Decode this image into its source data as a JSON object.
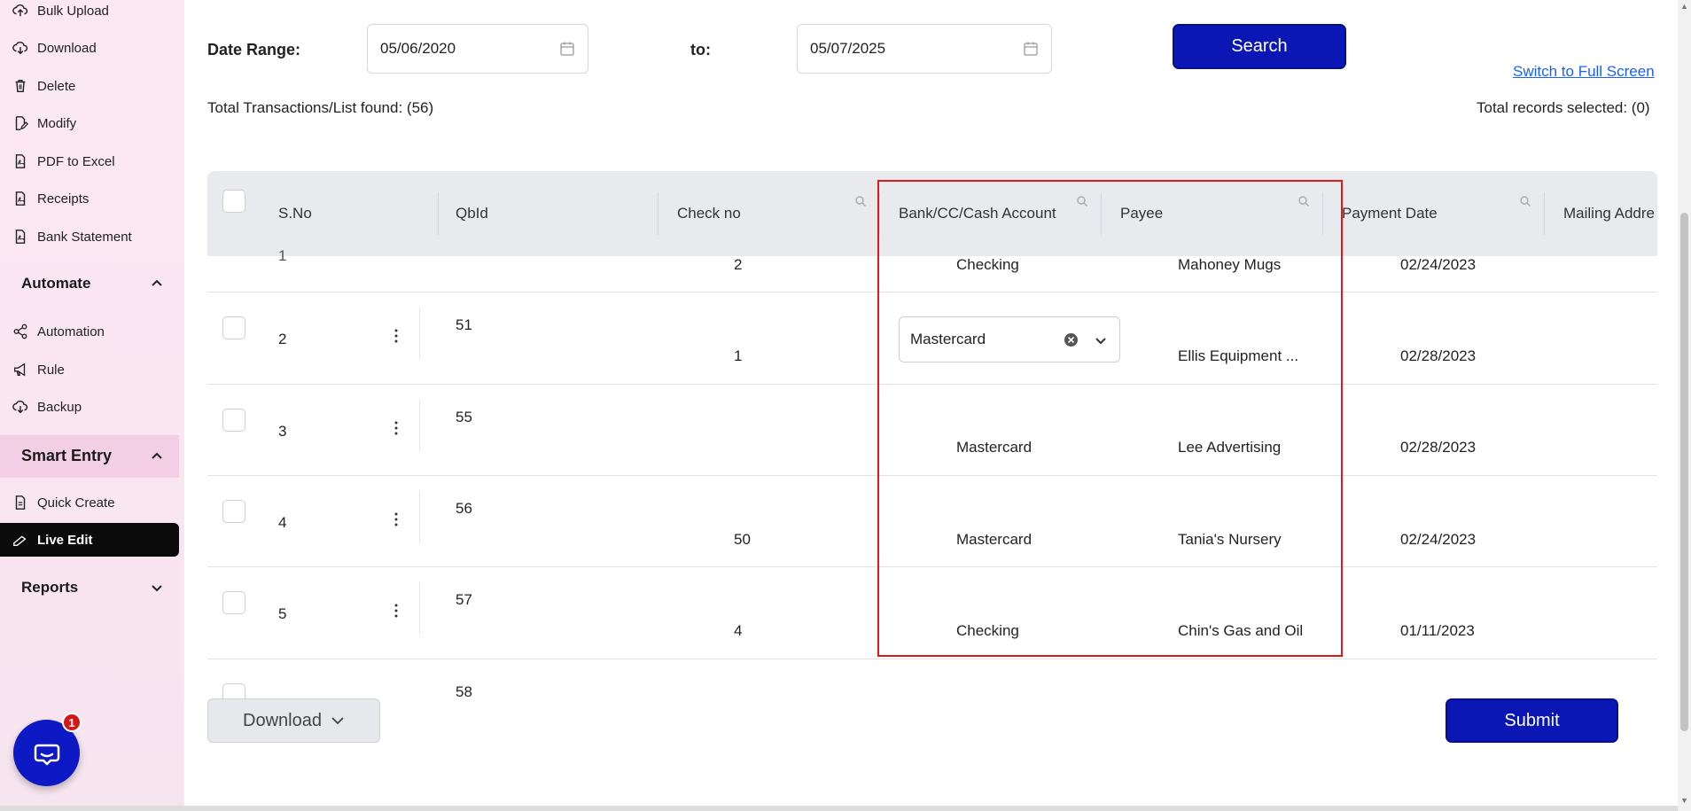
{
  "sidebar": {
    "items_top": [
      {
        "label": "Bulk Upload",
        "icon": "upload-icon"
      },
      {
        "label": "Download",
        "icon": "download-icon"
      },
      {
        "label": "Delete",
        "icon": "trash-icon"
      },
      {
        "label": "Modify",
        "icon": "edit-doc-icon"
      },
      {
        "label": "PDF to Excel",
        "icon": "pdf-icon"
      },
      {
        "label": "Receipts",
        "icon": "receipt-icon"
      },
      {
        "label": "Bank Statement",
        "icon": "statement-icon"
      }
    ],
    "automate": {
      "label": "Automate",
      "chevron": "chevron-up-icon"
    },
    "automate_items": [
      {
        "label": "Automation",
        "icon": "share-nodes-icon"
      },
      {
        "label": "Rule",
        "icon": "megaphone-icon"
      },
      {
        "label": "Backup",
        "icon": "cloud-backup-icon"
      }
    ],
    "smart_entry": {
      "label": "Smart Entry",
      "chevron": "chevron-up-icon"
    },
    "smart_items": [
      {
        "label": "Quick Create",
        "icon": "document-icon"
      },
      {
        "label": "Live Edit",
        "icon": "pen-icon"
      }
    ],
    "reports": {
      "label": "Reports",
      "chevron": "chevron-down-icon"
    }
  },
  "filters": {
    "date_range_label": "Date Range:",
    "from_date": "05/06/2020",
    "to_label": "to:",
    "to_date": "05/07/2025",
    "search_label": "Search",
    "switch_fullscreen": "Switch to Full Screen",
    "total_found": "Total Transactions/List found: (56)",
    "total_selected": "Total records selected: (0)"
  },
  "table": {
    "headers": {
      "sno": "S.No",
      "qbid": "QbId",
      "check_no": "Check no",
      "account": "Bank/CC/Cash Account",
      "payee": "Payee",
      "payment_date": "Payment Date",
      "mailing": "Mailing Addre"
    },
    "partial_top_row": {
      "sno": "1",
      "check_no": "2",
      "account": "Checking",
      "payee": "Mahoney Mugs",
      "date": "02/24/2023"
    },
    "rows": [
      {
        "sno": "2",
        "qbid": "51",
        "check_no": "1",
        "account": "Mastercard",
        "payee": "Ellis Equipment ...",
        "date": "02/28/2023"
      },
      {
        "sno": "3",
        "qbid": "55",
        "check_no": "",
        "account": "Mastercard",
        "payee": "Lee Advertising",
        "date": "02/28/2023"
      },
      {
        "sno": "4",
        "qbid": "56",
        "check_no": "50",
        "account": "Mastercard",
        "payee": "Tania's Nursery",
        "date": "02/24/2023"
      },
      {
        "sno": "5",
        "qbid": "57",
        "check_no": "4",
        "account": "Checking",
        "payee": "Chin's Gas and Oil",
        "date": "01/11/2023"
      }
    ],
    "partial_bottom_row": {
      "qbid": "58"
    }
  },
  "footer": {
    "download_label": "Download",
    "submit_label": "Submit"
  },
  "chat": {
    "badge_count": "1"
  },
  "colors": {
    "primary": "#0a17b5",
    "highlight": "#e01a1a",
    "link": "#1a5fff"
  }
}
